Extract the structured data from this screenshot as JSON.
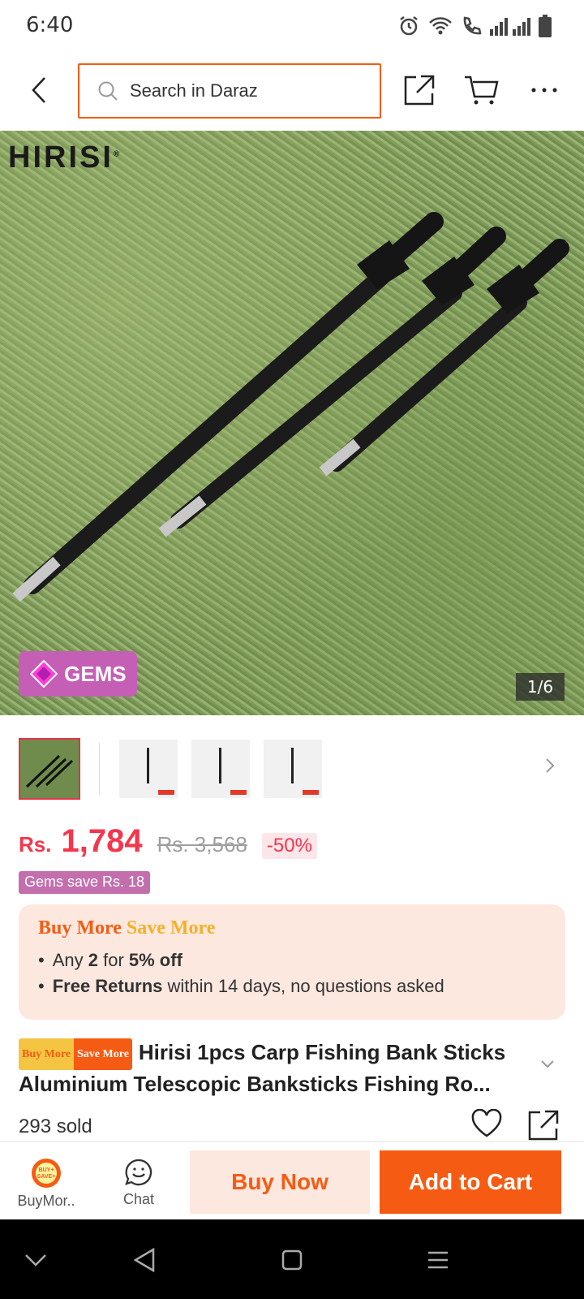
{
  "status_bar": {
    "time": "6:40"
  },
  "header": {
    "search_placeholder": "Search in Daraz",
    "icons": [
      "back-icon",
      "search-icon",
      "share-icon",
      "cart-icon",
      "more-icon"
    ]
  },
  "gallery": {
    "brand_watermark": "HIRISI",
    "gems_chip": "GEMS",
    "counter": "1/6",
    "thumbnail_count": 4
  },
  "price": {
    "currency": "Rs.",
    "current": "1,784",
    "original": "Rs. 3,568",
    "discount": "-50%",
    "gems_save": "Gems save Rs. 18"
  },
  "promo": {
    "title_part1": "Buy More",
    "title_part2": "Save More",
    "line1_pre": "Any ",
    "line1_bold1": "2",
    "line1_mid": " for ",
    "line1_bold2": "5% off",
    "line2_bold": "Free Returns",
    "line2_rest": " within 14 days, no questions asked"
  },
  "product": {
    "badge_part1": "Buy More",
    "badge_part2": "Save More",
    "title": "Hirisi 1pcs Carp Fishing Bank Sticks Aluminium Telescopic Banksticks Fishing Ro...",
    "sold": "293 sold"
  },
  "action_bar": {
    "buymore_label": "BuyMor..",
    "buymore_icon_text": "BUY+ SAVE+",
    "chat_label": "Chat",
    "buy_now": "Buy Now",
    "add_to_cart": "Add to Cart"
  },
  "colors": {
    "accent": "#f65b13",
    "price": "#f4364c",
    "gems": "#c55fb6"
  }
}
